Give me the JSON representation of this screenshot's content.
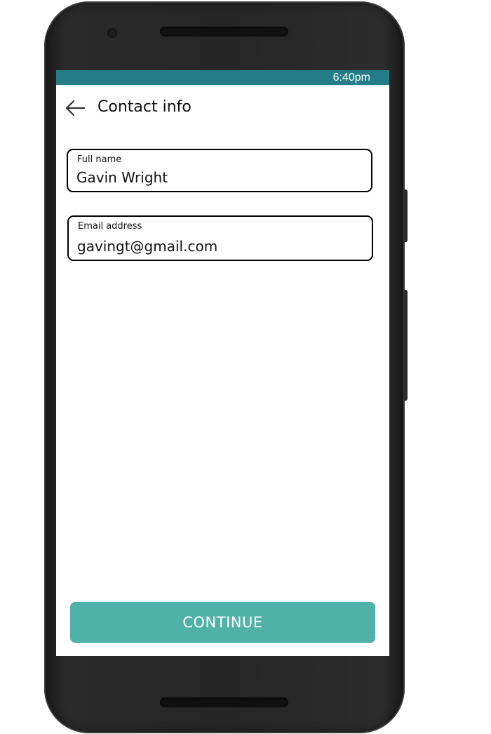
{
  "status_bar": {
    "time": "6:40pm",
    "color": "#237c86"
  },
  "app_bar": {
    "back_icon": "arrow-left-icon",
    "title": "Contact info"
  },
  "form": {
    "full_name": {
      "label": "Full name",
      "value": "Gavin Wright"
    },
    "email": {
      "label": "Email address",
      "value": "gavingt@gmail.com"
    }
  },
  "continue_button": {
    "label": "CONTINUE",
    "color": "#4fb1a7"
  }
}
